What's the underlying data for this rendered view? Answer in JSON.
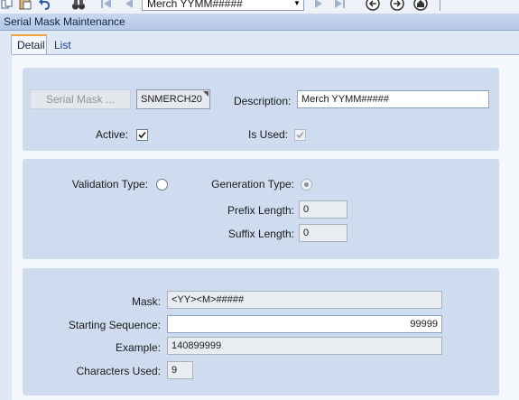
{
  "toolbar": {
    "record_value": "Merch YYMM#####",
    "icons": [
      "copy-icon",
      "paste-icon",
      "undo-icon",
      "binoculars-icon",
      "first-record-icon",
      "previous-record-icon",
      "next-record-icon",
      "last-record-icon",
      "back-icon",
      "forward-icon",
      "home-icon"
    ]
  },
  "window": {
    "title": "Serial Mask Maintenance"
  },
  "tabs": [
    {
      "label": "Detail",
      "active": true
    },
    {
      "label": "List",
      "active": false
    }
  ],
  "header": {
    "serial_mask_button": "Serial Mask ...",
    "serial_mask_code": "SNMERCH20",
    "description_label": "Description:",
    "description_value": "Merch YYMM#####",
    "active_label": "Active:",
    "active_checked": true,
    "is_used_label": "Is Used:",
    "is_used_checked": true
  },
  "settings": {
    "validation_type_label": "Validation Type:",
    "validation_type_selected": false,
    "generation_type_label": "Generation Type:",
    "generation_type_selected": true,
    "prefix_length_label": "Prefix Length:",
    "prefix_length_value": "0",
    "suffix_length_label": "Suffix Length:",
    "suffix_length_value": "0"
  },
  "mask_details": {
    "mask_label": "Mask:",
    "mask_value": "<YY><M>#####",
    "starting_sequence_label": "Starting Sequence:",
    "starting_sequence_value": "99999",
    "example_label": "Example:",
    "example_value": "140899999",
    "characters_used_label": "Characters Used:",
    "characters_used_value": "9"
  },
  "colors": {
    "panel": "#cfdcef",
    "titlebar": "#b4c8e6",
    "tab_accent": "#f2a43a"
  }
}
